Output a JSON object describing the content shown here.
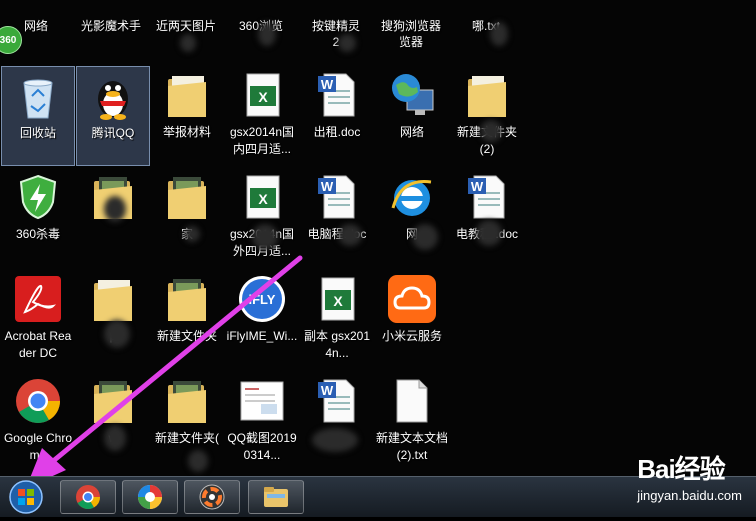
{
  "desktop": {
    "top_row": [
      "网络",
      "光影魔术手",
      "近两天图片",
      "360浏览",
      "按键精灵",
      "搜狗浏览器",
      "哪.txt"
    ],
    "top_row_extra": [
      "",
      "",
      "",
      "",
      "2",
      "览器",
      ""
    ],
    "badge_360": "360",
    "icons": [
      {
        "label": "回收站",
        "selected": true,
        "kind": "recycle-bin"
      },
      {
        "label": "腾讯QQ",
        "selected": true,
        "kind": "qq"
      },
      {
        "label": "举报材料",
        "kind": "folder"
      },
      {
        "label": "gsx2014n国内四月适...",
        "kind": "excel"
      },
      {
        "label": "出租.doc",
        "kind": "word"
      },
      {
        "label": "网络",
        "kind": "network"
      },
      {
        "label": "新建文件夹(2)",
        "kind": "folder"
      },
      {
        "label": "360杀毒",
        "kind": "360-antivirus"
      },
      {
        "label": "",
        "kind": "folder-photo"
      },
      {
        "label": "家",
        "kind": "folder-photo"
      },
      {
        "label": "gsx2014n国外四月适...",
        "kind": "excel"
      },
      {
        "label": "电脑程.doc",
        "kind": "word"
      },
      {
        "label": "网",
        "kind": "ie"
      },
      {
        "label": "电教程 .doc",
        "kind": "word"
      },
      {
        "label": "Acrobat Reader DC",
        "kind": "acrobat"
      },
      {
        "label": "p",
        "kind": "folder"
      },
      {
        "label": "新建文件夹",
        "kind": "folder-photo"
      },
      {
        "label": "iFlyIME_Wi...",
        "kind": "ifly"
      },
      {
        "label": "副本 gsx2014n...",
        "kind": "excel"
      },
      {
        "label": "小米云服务",
        "kind": "xiaomi-cloud"
      },
      {
        "label": "Google Chrome",
        "kind": "chrome"
      },
      {
        "label": "w",
        "kind": "folder-photo"
      },
      {
        "label": "新建文件夹(",
        "kind": "folder-photo"
      },
      {
        "label": "QQ截图20190314...",
        "kind": "screenshot"
      },
      {
        "label": "",
        "kind": "word"
      },
      {
        "label": "新建文本文档 (2).txt",
        "kind": "text"
      }
    ]
  },
  "taskbar": {
    "items": [
      "start-orb",
      "chrome",
      "360-browser",
      "color-wheel-app",
      "file-explorer"
    ]
  },
  "watermark": {
    "logo": "Bai经验",
    "url": "jingyan.baidu.com"
  },
  "colors": {
    "arrow": "#e040e8",
    "selection": "#7896c8",
    "taskbar": "#1c232c"
  }
}
